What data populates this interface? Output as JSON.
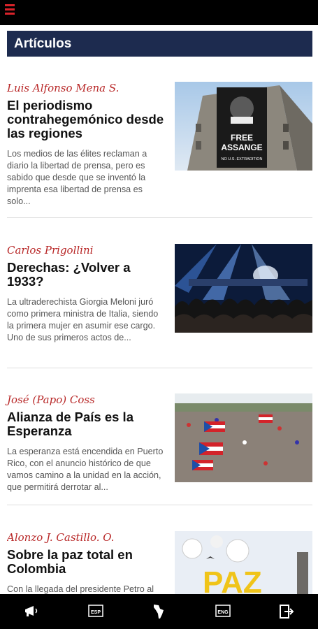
{
  "app": {
    "menu_icon": "hamburger-menu-icon",
    "accent_color": "#d9232a",
    "header_color": "#1d2b4f"
  },
  "section": {
    "title": "Artículos"
  },
  "articles": [
    {
      "author": "Luis Alfonso Mena S.",
      "title": "El periodismo contrahegemónico desde las regiones",
      "excerpt": "Los medios de las élites reclaman a diario la libertad de prensa, pero es sabido que desde que se inventó la imprenta esa libertad de prensa es solo...",
      "image": "free-assange-poster-photo",
      "image_text": [
        "FREE",
        "ASSANGE",
        "NO U.S. EXTRADITION"
      ]
    },
    {
      "author": "Carlos Prigollini",
      "title": "Derechas: ¿Volver a 1933?",
      "excerpt": "La ultraderechista Giorgia Meloni juró como primera ministra de Italia, siendo la primera mujer en asumir ese cargo. Uno de sus primeros actos de...",
      "image": "concert-crowd-photo"
    },
    {
      "author": "José (Papo) Coss",
      "title": "Alianza de País es la Esperanza",
      "excerpt": "La esperanza está encendida en Puerto Rico, con el anuncio histórico de que vamos camino a la unidad en la acción, que permitirá derrotar al...",
      "image": "puerto-rico-flags-march-photo"
    },
    {
      "author": "Alonzo J. Castillo. O.",
      "title": "Sobre la paz total en Colombia",
      "excerpt": "Con la llegada del presidente Petro al",
      "image": "paz-sign-photo",
      "image_text": "PAZ"
    }
  ],
  "bottom_nav": [
    {
      "icon": "megaphone-icon"
    },
    {
      "icon": "esp-language-icon",
      "label": "ESP"
    },
    {
      "icon": "latin-america-map-icon"
    },
    {
      "icon": "eng-language-icon",
      "label": "ENG"
    },
    {
      "icon": "logout-icon"
    }
  ]
}
